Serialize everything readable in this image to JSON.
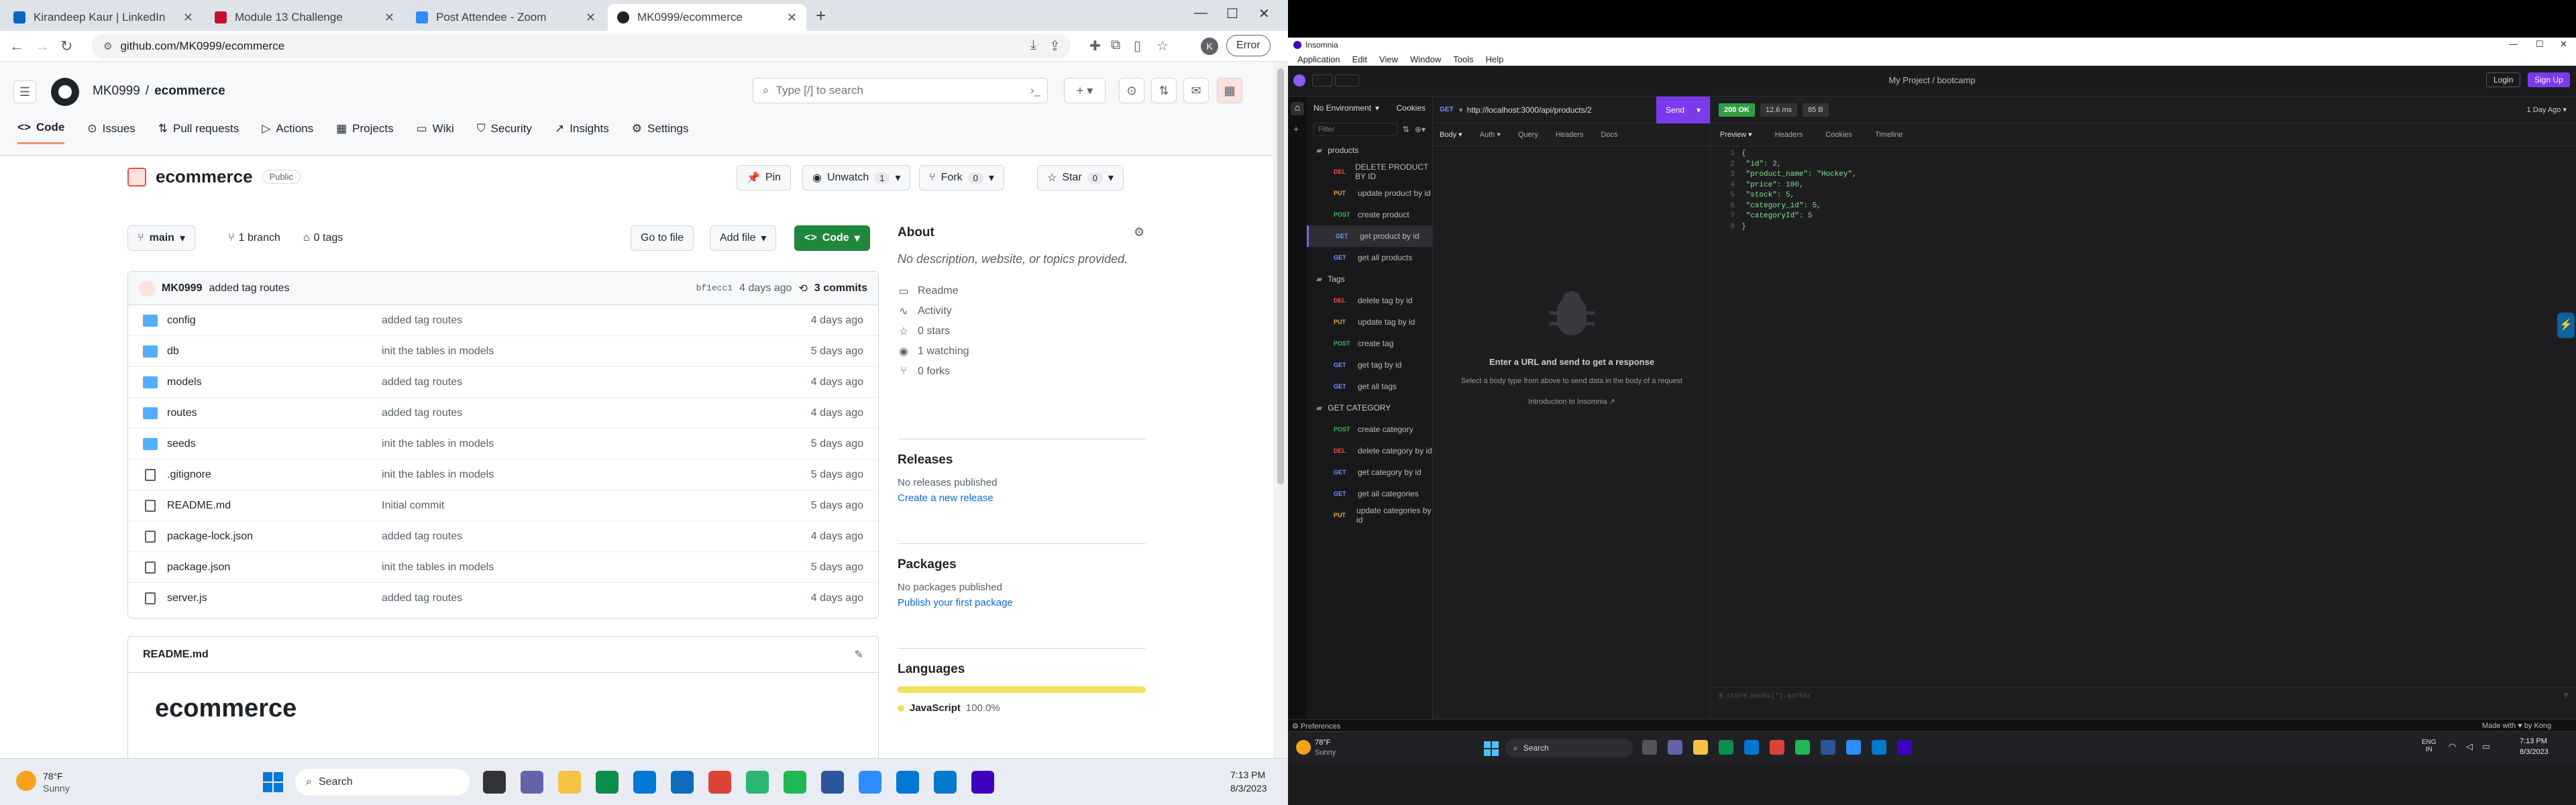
{
  "browser": {
    "tabs": [
      {
        "title": "Kirandeep Kaur | LinkedIn",
        "color": "#0a66c2"
      },
      {
        "title": "Module 13 Challenge",
        "color": "#c8102e"
      },
      {
        "title": "Post Attendee - Zoom",
        "color": "#2d8cff"
      },
      {
        "title": "MK0999/ecommerce",
        "color": "#1f2328"
      }
    ],
    "url": "github.com/MK0999/ecommerce",
    "error_label": "Error",
    "avatar_letter": "K"
  },
  "github": {
    "owner": "MK0999",
    "repo": "ecommerce",
    "search_placeholder": "Type [/] to search",
    "nav": [
      "Code",
      "Issues",
      "Pull requests",
      "Actions",
      "Projects",
      "Wiki",
      "Security",
      "Insights",
      "Settings"
    ],
    "visibility": "Public",
    "pin": "Pin",
    "unwatch": "Unwatch",
    "unwatch_count": "1",
    "fork": "Fork",
    "fork_count": "0",
    "star": "Star",
    "star_count": "0",
    "branch": "main",
    "branches": "1 branch",
    "tags": "0 tags",
    "goto_file": "Go to file",
    "add_file": "Add file",
    "code_btn": "Code",
    "last_commit": {
      "author": "MK0999",
      "message": "added tag routes",
      "hash": "bf1ecc1",
      "time": "4 days ago",
      "commits": "3 commits"
    },
    "files": [
      {
        "name": "config",
        "type": "dir",
        "msg": "added tag routes",
        "date": "4 days ago"
      },
      {
        "name": "db",
        "type": "dir",
        "msg": "init the tables in models",
        "date": "5 days ago"
      },
      {
        "name": "models",
        "type": "dir",
        "msg": "added tag routes",
        "date": "4 days ago"
      },
      {
        "name": "routes",
        "type": "dir",
        "msg": "added tag routes",
        "date": "4 days ago"
      },
      {
        "name": "seeds",
        "type": "dir",
        "msg": "init the tables in models",
        "date": "5 days ago"
      },
      {
        "name": ".gitignore",
        "type": "file",
        "msg": "init the tables in models",
        "date": "5 days ago"
      },
      {
        "name": "README.md",
        "type": "file",
        "msg": "Initial commit",
        "date": "5 days ago"
      },
      {
        "name": "package-lock.json",
        "type": "file",
        "msg": "added tag routes",
        "date": "4 days ago"
      },
      {
        "name": "package.json",
        "type": "file",
        "msg": "init the tables in models",
        "date": "5 days ago"
      },
      {
        "name": "server.js",
        "type": "file",
        "msg": "added tag routes",
        "date": "4 days ago"
      }
    ],
    "readme_file": "README.md",
    "readme_title": "ecommerce",
    "about": {
      "title": "About",
      "desc": "No description, website, or topics provided.",
      "items": [
        "Readme",
        "Activity",
        "0 stars",
        "1 watching",
        "0 forks"
      ]
    },
    "releases": {
      "title": "Releases",
      "text": "No releases published",
      "link": "Create a new release"
    },
    "packages": {
      "title": "Packages",
      "text": "No packages published",
      "link": "Publish your first package"
    },
    "languages": {
      "title": "Languages",
      "lang": "JavaScript",
      "pct": "100.0%",
      "color": "#f1e05a"
    }
  },
  "taskbar_left": {
    "temp": "78°F",
    "cond": "Sunny",
    "search": "Search",
    "time": "7:13 PM",
    "date": "8/3/2023"
  },
  "insomnia": {
    "app": "Insomnia",
    "menu": [
      "Application",
      "Edit",
      "View",
      "Window",
      "Tools",
      "Help"
    ],
    "project": "My Project / bootcamp",
    "login": "Login",
    "signup": "Sign Up",
    "env": "No Environment",
    "cookies": "Cookies",
    "filter": "Filter",
    "method": "GET",
    "url": "http://localhost:3000/api/products/2",
    "send": "Send",
    "status": "200 OK",
    "time": "12.6 ms",
    "size": "85 B",
    "age": "1 Day Ago",
    "req_tabs": [
      "Body",
      "Auth",
      "Query",
      "Headers",
      "Docs"
    ],
    "resp_tabs": [
      "Preview",
      "Headers",
      "Cookies",
      "Timeline"
    ],
    "empty_title": "Enter a URL and send to get a response",
    "empty_sub": "Select a body type from above to send data in the body of a request",
    "intro": "Introduction to Insomnia",
    "filter_hint": "$.store.books[*].author",
    "folders": [
      {
        "name": "products",
        "requests": [
          {
            "m": "DEL",
            "cls": "del",
            "name": "DELETE PRODUCT BY ID"
          },
          {
            "m": "PUT",
            "cls": "put",
            "name": "update product by id"
          },
          {
            "m": "POST",
            "cls": "post",
            "name": "create product"
          },
          {
            "m": "GET",
            "cls": "get",
            "name": "get product by id",
            "sel": true
          },
          {
            "m": "GET",
            "cls": "get",
            "name": "get all products"
          }
        ]
      },
      {
        "name": "Tags",
        "requests": [
          {
            "m": "DEL",
            "cls": "del",
            "name": "delete tag by id"
          },
          {
            "m": "PUT",
            "cls": "put",
            "name": "update tag by id"
          },
          {
            "m": "POST",
            "cls": "post",
            "name": "create tag"
          },
          {
            "m": "GET",
            "cls": "get",
            "name": "get tag by id"
          },
          {
            "m": "GET",
            "cls": "get",
            "name": "get all tags"
          }
        ]
      },
      {
        "name": "GET CATEGORY",
        "requests": [
          {
            "m": "POST",
            "cls": "post",
            "name": "create category"
          },
          {
            "m": "DEL",
            "cls": "del",
            "name": "delete category by id"
          },
          {
            "m": "GET",
            "cls": "get",
            "name": "get category by id"
          },
          {
            "m": "GET",
            "cls": "get",
            "name": "get all categories"
          },
          {
            "m": "PUT",
            "cls": "put",
            "name": "update categories by id"
          }
        ]
      }
    ],
    "response_lines": [
      "{",
      "  \"id\": 2,",
      "  \"product_name\": \"Hockey\",",
      "  \"price\": 100,",
      "  \"stock\": 5,",
      "  \"category_id\": 5,",
      "  \"categoryId\": 5",
      "}"
    ],
    "preferences": "Preferences",
    "made_with": "Made with ♥ by Kong"
  },
  "taskbar_right": {
    "temp": "78°F",
    "cond": "Sunny",
    "search": "Search",
    "lang": "ENG",
    "region": "IN",
    "time": "7:13 PM",
    "date": "8/3/2023"
  }
}
